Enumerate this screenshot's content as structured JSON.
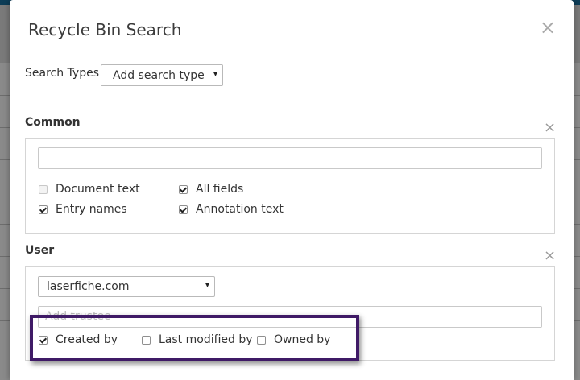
{
  "dialog": {
    "title": "Recycle Bin Search",
    "close_glyph": "×"
  },
  "search_types": {
    "label": "Search Types",
    "select_value": "Add search type",
    "arrow": "▾"
  },
  "common": {
    "title": "Common",
    "remove_glyph": "×",
    "input_value": "",
    "options": [
      {
        "label": "Document text",
        "checked": false,
        "disabled": true
      },
      {
        "label": "All fields",
        "checked": true,
        "disabled": false
      },
      {
        "label": "Entry names",
        "checked": true,
        "disabled": false
      },
      {
        "label": "Annotation text",
        "checked": true,
        "disabled": false
      }
    ]
  },
  "user": {
    "title": "User",
    "remove_glyph": "×",
    "domain_value": "laserfiche.com",
    "domain_arrow": "▾",
    "trustee_placeholder": "Add trustee",
    "options": [
      {
        "label": "Created by",
        "checked": true
      },
      {
        "label": "Last modified by",
        "checked": false
      },
      {
        "label": "Owned by",
        "checked": false
      }
    ]
  },
  "colors": {
    "highlight_border": "#3f1a66",
    "topbar": "#0d3d57"
  }
}
